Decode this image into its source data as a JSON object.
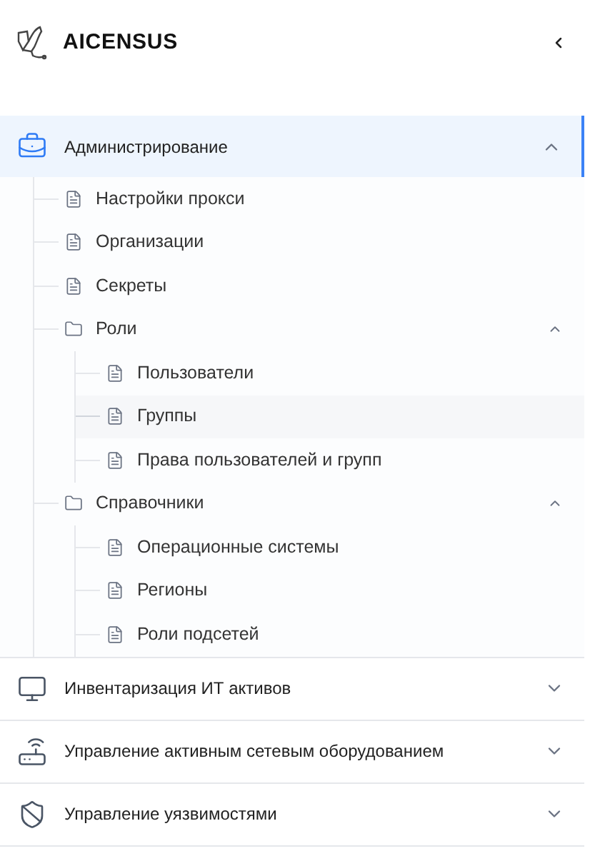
{
  "brand": {
    "name": "AICENSUS"
  },
  "sections": [
    {
      "title": "Администрирование",
      "kind": "briefcase",
      "expanded": true,
      "selected": true,
      "children": [
        {
          "label": "Настройки прокси",
          "kind": "page",
          "selected": false
        },
        {
          "label": "Организации",
          "kind": "page",
          "selected": false
        },
        {
          "label": "Секреты",
          "kind": "page",
          "selected": false
        },
        {
          "label": "Роли",
          "kind": "folder",
          "expanded": true,
          "selected": false,
          "children": [
            {
              "label": "Пользователи",
              "kind": "page",
              "selected": false
            },
            {
              "label": "Группы",
              "kind": "page",
              "selected": true
            },
            {
              "label": "Права пользователей и групп",
              "kind": "page",
              "selected": false
            }
          ]
        },
        {
          "label": "Справочники",
          "kind": "folder",
          "expanded": true,
          "selected": false,
          "children": [
            {
              "label": "Операционные системы",
              "kind": "page",
              "selected": false
            },
            {
              "label": "Регионы",
              "kind": "page",
              "selected": false
            },
            {
              "label": "Роли подсетей",
              "kind": "page",
              "selected": false
            }
          ]
        }
      ]
    },
    {
      "title": "Инвентаризация ИТ активов",
      "kind": "monitor",
      "expanded": false,
      "selected": false
    },
    {
      "title": "Управление активным сетевым оборудованием",
      "kind": "router",
      "expanded": false,
      "selected": false
    },
    {
      "title": "Управление уязвимостями",
      "kind": "shield",
      "expanded": false,
      "selected": false
    }
  ]
}
